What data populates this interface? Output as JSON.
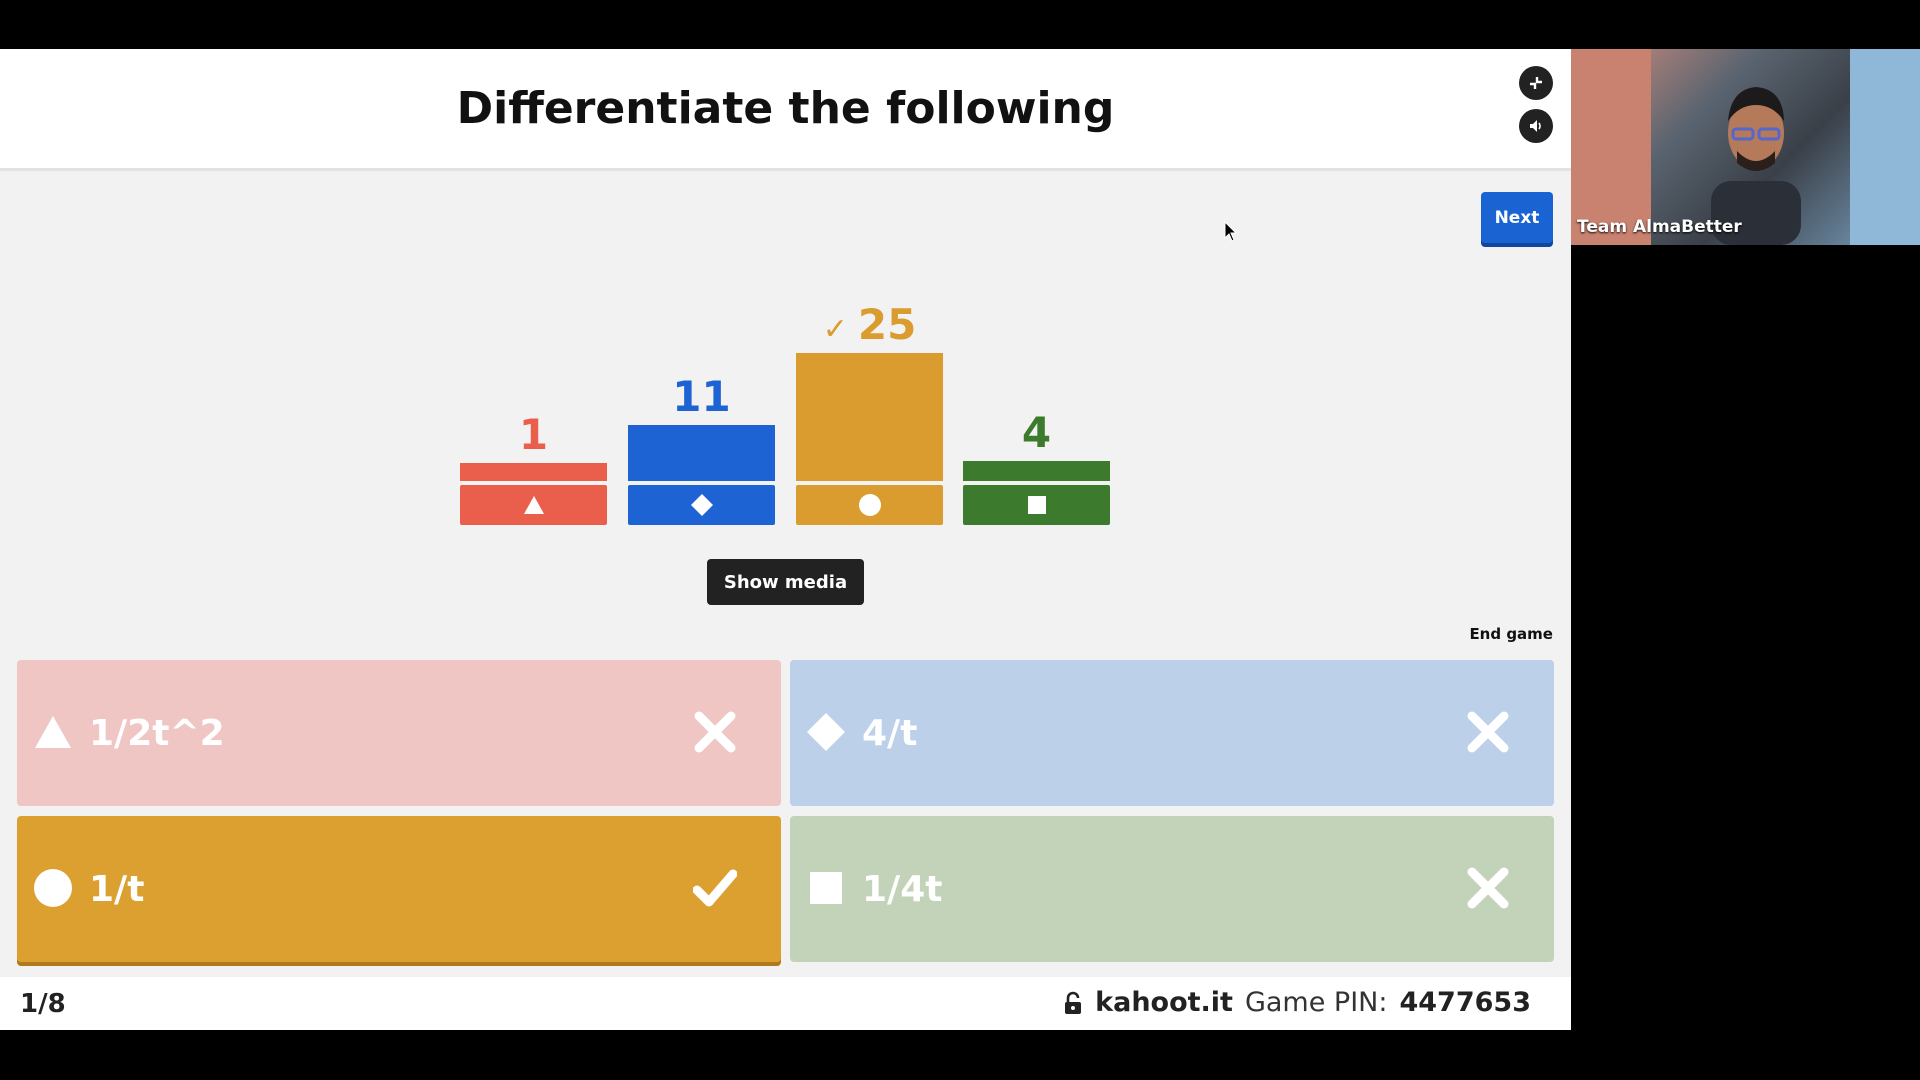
{
  "question": {
    "title": "Differentiate the following"
  },
  "controls": {
    "next_label": "Next",
    "show_media_label": "Show media",
    "end_game_label": "End game"
  },
  "colors": {
    "red": "#e95f4c",
    "blue": "#1d63d3",
    "yellow": "#da9b2f",
    "green": "#3c7a2e"
  },
  "results": [
    {
      "shape": "triangle-icon",
      "count": "1",
      "color": "#e95f4c",
      "correct": false,
      "check": ""
    },
    {
      "shape": "diamond-icon",
      "count": "11",
      "color": "#1d63d3",
      "correct": false,
      "check": ""
    },
    {
      "shape": "circle-icon",
      "count": "25",
      "color": "#da9b2f",
      "correct": true,
      "check": "✓"
    },
    {
      "shape": "square-icon",
      "count": "4",
      "color": "#3c7a2e",
      "correct": false,
      "check": ""
    }
  ],
  "answers": [
    {
      "shape": "triangle-icon",
      "text": "1/2t^2",
      "correct": false,
      "bg": "#efc6c4"
    },
    {
      "shape": "diamond-icon",
      "text": "4/t",
      "correct": false,
      "bg": "#bcd0ea"
    },
    {
      "shape": "circle-icon",
      "text": "1/t",
      "correct": true,
      "bg": "#dba030"
    },
    {
      "shape": "square-icon",
      "text": "1/4t",
      "correct": false,
      "bg": "#c3d3ba"
    }
  ],
  "footer": {
    "counter": "1/8",
    "url": "kahoot.it",
    "pin_label": "Game PIN:",
    "pin_value": "4477653"
  },
  "video": {
    "participant_name": "Team AlmaBetter"
  }
}
